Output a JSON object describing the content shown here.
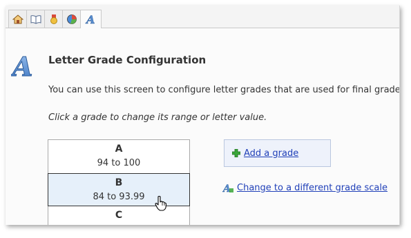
{
  "tabs": [
    {
      "icon": "home-icon"
    },
    {
      "icon": "book-icon"
    },
    {
      "icon": "medal-icon"
    },
    {
      "icon": "pie-chart-icon"
    },
    {
      "icon": "letter-a-icon",
      "active": true
    }
  ],
  "page": {
    "title": "Letter Grade Configuration",
    "description": "You can use this screen to configure letter grades that are used for final grade",
    "hint": "Click a grade to change its range or letter value."
  },
  "grades": [
    {
      "letter": "A",
      "range": "94 to 100"
    },
    {
      "letter": "B",
      "range": "84 to 93.99",
      "selected": true
    },
    {
      "letter": "C",
      "range": ""
    }
  ],
  "actions": {
    "add_grade": "Add a grade",
    "change_scale": "Change to a different grade scale"
  },
  "colors": {
    "link": "#1f3fb8",
    "selected_row": "#e6f0fa",
    "add_box": "#eef2fb"
  }
}
